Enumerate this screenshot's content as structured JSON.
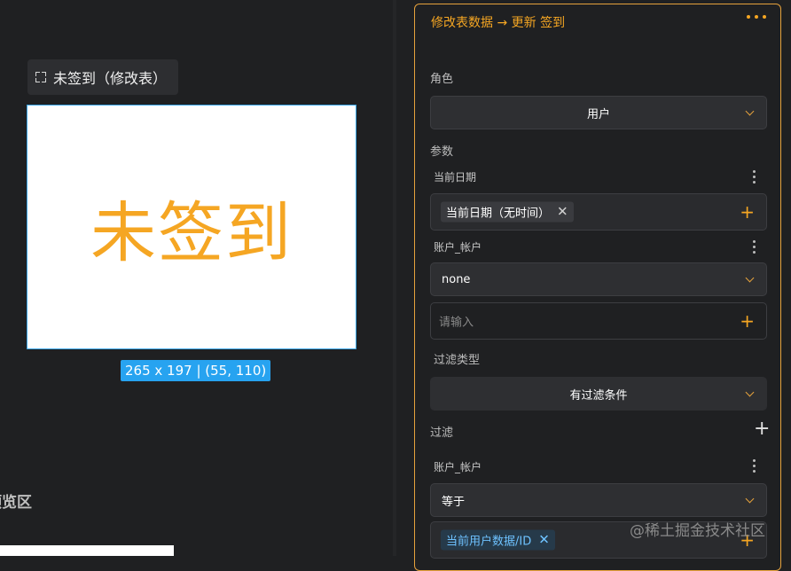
{
  "canvas": {
    "component_label": "未签到（修改表）",
    "component_text": "未签到",
    "size_badge": "265 x 197 | (55, 110)",
    "preview_label": "预览区"
  },
  "panel": {
    "title": "修改表数据 → 更新 签到",
    "role_label": "角色",
    "role_value": "用户",
    "params_label": "参数",
    "param1": {
      "label": "当前日期",
      "tag": "当前日期（无时间）",
      "tag_remove": "✕",
      "add": "+"
    },
    "param2": {
      "label": "账户_帐户",
      "value": "none",
      "input_placeholder": "请输入",
      "add": "+"
    },
    "filter_type_label": "过滤类型",
    "filter_type_value": "有过滤条件",
    "filter_label": "过滤",
    "filter_add": "+",
    "filter1": {
      "label": "账户_帐户",
      "operator": "等于",
      "tag": "当前用户数据/ID",
      "tag_remove": "✕",
      "add": "+"
    }
  },
  "watermark": "@稀土掘金技术社区",
  "colors": {
    "accent": "#f5a623",
    "selection": "#27a3f0",
    "tag_blue": "#6ec2ff"
  }
}
